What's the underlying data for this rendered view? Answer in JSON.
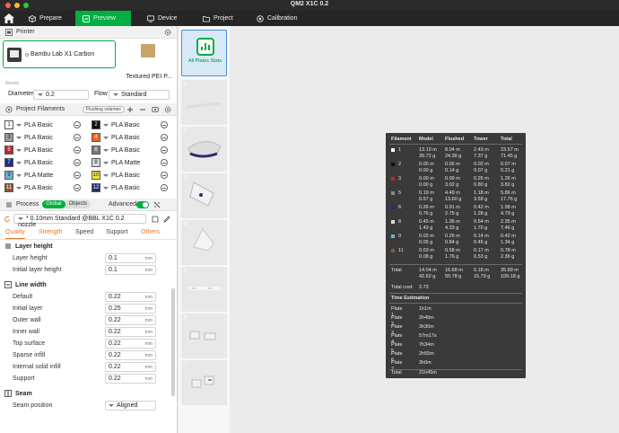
{
  "window": {
    "title": "QM2 X1C 0.2"
  },
  "nav": {
    "tabs": [
      {
        "label": "Prepare",
        "icon": "cube-icon"
      },
      {
        "label": "Preview",
        "icon": "preview-icon",
        "active": true
      },
      {
        "label": "Device",
        "icon": "monitor-icon"
      },
      {
        "label": "Project",
        "icon": "folder-icon"
      },
      {
        "label": "Calibration",
        "icon": "target-icon"
      }
    ]
  },
  "printer": {
    "section_label": "Printer",
    "name": "Bambu Lab X1 Carbon",
    "plate": "Textured PEI P...",
    "nozzle_caption": "Nozzle",
    "diameter_label": "Diameter",
    "diameter_value": "0.2",
    "flow_label": "Flow",
    "flow_value": "Standard"
  },
  "filaments": {
    "section_label": "Project Filaments",
    "flushing_label": "Flushing volumes",
    "items": [
      {
        "num": "1",
        "name": "PLA Basic",
        "color": "#ffffff",
        "num_color": "#222222"
      },
      {
        "num": "2",
        "name": "PLA Basic",
        "color": "#111111",
        "num_color": "#ffffff"
      },
      {
        "num": "3",
        "name": "PLA Basic",
        "color": "#9a9a9a",
        "num_color": "#222222"
      },
      {
        "num": "4",
        "name": "PLA Basic",
        "color": "#ee6a1e",
        "num_color": "#ffffff"
      },
      {
        "num": "5",
        "name": "PLA Basic",
        "color": "#c8242c",
        "num_color": "#ffffff"
      },
      {
        "num": "6",
        "name": "PLA Basic",
        "color": "#7a7a7a",
        "num_color": "#ffffff"
      },
      {
        "num": "7",
        "name": "PLA Basic",
        "color": "#1f2f8a",
        "num_color": "#ffffff"
      },
      {
        "num": "8",
        "name": "PLA Matte",
        "color": "#d8d8d8",
        "num_color": "#222222"
      },
      {
        "num": "9",
        "name": "PLA Matte",
        "color": "#6fb3d6",
        "num_color": "#222222"
      },
      {
        "num": "10",
        "name": "PLA Basic",
        "color": "#f2e52a",
        "num_color": "#222222"
      },
      {
        "num": "11",
        "name": "PLA Basic",
        "color": "#8b5a3a",
        "num_color": "#ffffff"
      },
      {
        "num": "12",
        "name": "PLA Basic",
        "color": "#2b2a6a",
        "num_color": "#ffffff"
      }
    ]
  },
  "process": {
    "section_label": "Process",
    "toggle_global": "Global",
    "toggle_objects": "Objects",
    "advanced_label": "Advanced",
    "preset": "* 0.10mm Standard @BBL X1C 0.2 nozzle",
    "tabs": [
      "Quality",
      "Strength",
      "Speed",
      "Support",
      "Others"
    ],
    "groups": {
      "layer_height": {
        "title": "Layer height",
        "params": [
          {
            "label": "Layer height",
            "value": "0.1",
            "unit": "mm"
          },
          {
            "label": "Initial layer height",
            "value": "0.1",
            "unit": "mm"
          }
        ]
      },
      "line_width": {
        "title": "Line width",
        "params": [
          {
            "label": "Default",
            "value": "0.22",
            "unit": "mm"
          },
          {
            "label": "Initial layer",
            "value": "0.25",
            "unit": "mm"
          },
          {
            "label": "Outer wall",
            "value": "0.22",
            "unit": "mm"
          },
          {
            "label": "Inner wall",
            "value": "0.22",
            "unit": "mm"
          },
          {
            "label": "Top surface",
            "value": "0.22",
            "unit": "mm"
          },
          {
            "label": "Sparse infill",
            "value": "0.22",
            "unit": "mm"
          },
          {
            "label": "Internal solid infill",
            "value": "0.22",
            "unit": "mm"
          },
          {
            "label": "Support",
            "value": "0.22",
            "unit": "mm"
          }
        ]
      },
      "seam": {
        "title": "Seam",
        "params": [
          {
            "label": "Seam position",
            "value": "Aligned"
          }
        ]
      }
    }
  },
  "plates": {
    "stats_label": "All Plates Stats",
    "items": [
      "1",
      "2",
      "3",
      "4",
      "5",
      "6",
      "7"
    ]
  },
  "stats": {
    "headers": [
      "Filament",
      "Model",
      "Flushed",
      "Tower",
      "Total"
    ],
    "rows": [
      {
        "id": "1",
        "color": "#ffffff",
        "model": [
          "13.10 m",
          "39.72 g"
        ],
        "flushed": [
          "8.04 m",
          "24.36 g"
        ],
        "tower": [
          "2.43 m",
          "7.37 g"
        ],
        "total": [
          "23.57 m",
          "71.45 g"
        ]
      },
      {
        "id": "2",
        "color": "#111111",
        "model": [
          "0.00 m",
          "0.00 g"
        ],
        "flushed": [
          "0.05 m",
          "0.14 g"
        ],
        "tower": [
          "0.02 m",
          "0.07 g"
        ],
        "total": [
          "0.07 m",
          "0.21 g"
        ]
      },
      {
        "id": "3",
        "color": "#c8242c",
        "model": [
          "0.00 m",
          "0.00 g"
        ],
        "flushed": [
          "0.99 m",
          "3.02 g"
        ],
        "tower": [
          "0.26 m",
          "0.80 g"
        ],
        "total": [
          "1.26 m",
          "3.82 g"
        ]
      },
      {
        "id": "5",
        "color": "#8a8a8a",
        "model": [
          "0.19 m",
          "0.57 g"
        ],
        "flushed": [
          "4.49 m",
          "13.60 g"
        ],
        "tower": [
          "1.18 m",
          "3.59 g"
        ],
        "total": [
          "5.86 m",
          "17.76 g"
        ]
      },
      {
        "id": "6",
        "color": "#1f2f8a",
        "model": [
          "0.26 m",
          "0.76 g"
        ],
        "flushed": [
          "0.91 m",
          "2.75 g"
        ],
        "tower": [
          "0.42 m",
          "1.28 g"
        ],
        "total": [
          "1.58 m",
          "4.79 g"
        ]
      },
      {
        "id": "8",
        "color": "#d8d8d8",
        "model": [
          "0.45 m",
          "1.43 g"
        ],
        "flushed": [
          "1.36 m",
          "4.33 g"
        ],
        "tower": [
          "0.54 m",
          "1.70 g"
        ],
        "total": [
          "2.35 m",
          "7.46 g"
        ]
      },
      {
        "id": "9",
        "color": "#6fb3d6",
        "model": [
          "0.02 m",
          "0.05 g"
        ],
        "flushed": [
          "0.26 m",
          "0.84 g"
        ],
        "tower": [
          "0.14 m",
          "0.45 g"
        ],
        "total": [
          "0.42 m",
          "1.34 g"
        ]
      },
      {
        "id": "11",
        "color": "#8b5a3a",
        "model": [
          "0.03 m",
          "0.08 g"
        ],
        "flushed": [
          "0.58 m",
          "1.76 g"
        ],
        "tower": [
          "0.17 m",
          "0.53 g"
        ],
        "total": [
          "0.78 m",
          "2.36 g"
        ]
      }
    ],
    "total_row": {
      "label": "Total",
      "model": [
        "14.04 m",
        "42.62 g"
      ],
      "flushed": [
        "16.68 m",
        "50.78 g"
      ],
      "tower": [
        "5.18 m",
        "15.79 g"
      ],
      "total": [
        "35.89 m",
        "109.18 g"
      ]
    },
    "total_cost_label": "Total cost:",
    "total_cost_value": "2.73",
    "time_heading": "Time Estimation",
    "times": [
      {
        "plate": "Plate 1",
        "time": "1h1m"
      },
      {
        "plate": "Plate 2",
        "time": "2h49m"
      },
      {
        "plate": "Plate 3",
        "time": "3h30m"
      },
      {
        "plate": "Plate 4",
        "time": "57m17s"
      },
      {
        "plate": "Plate 5",
        "time": "7h34m"
      },
      {
        "plate": "Plate 6",
        "time": "2h55m"
      },
      {
        "plate": "Plate 7",
        "time": "3h0m"
      }
    ],
    "time_total": {
      "label": "Total",
      "time": "21h45m"
    }
  }
}
